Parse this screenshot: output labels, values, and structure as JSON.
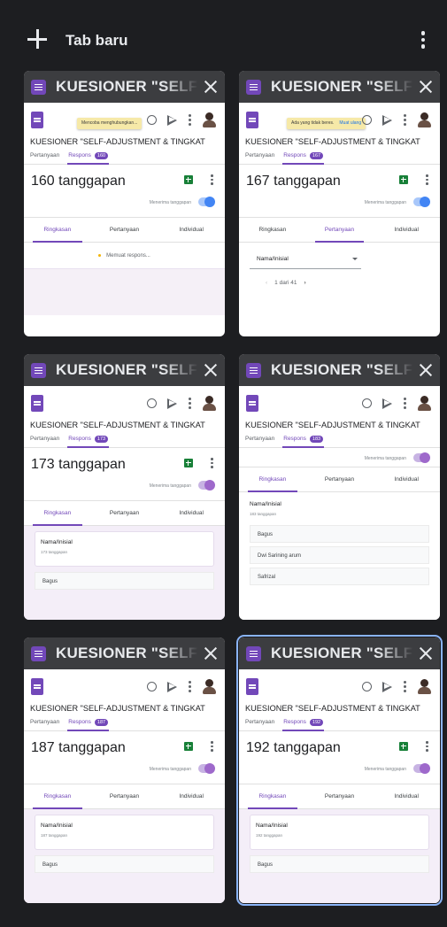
{
  "topbar": {
    "new_tab_label": "Tab baru"
  },
  "form": {
    "title": "KUESIONER \"SELF-ADJUSTMENT & TINGKAT",
    "tab_questions": "Pertanyaan",
    "tab_responses": "Respons",
    "accepting_label": "Menerima tanggapan",
    "subtab_summary": "Ringkasan",
    "subtab_question": "Pertanyaan",
    "subtab_individual": "Individual",
    "question_name": "Nama/Inisial"
  },
  "tabs": [
    {
      "title": "KUESIONER \"SELF",
      "badge": "160",
      "response_count": "160 tanggapan",
      "toast": "Mencoba menghubungkan...",
      "loading_text": "Memuat respons..."
    },
    {
      "title": "KUESIONER \"SELF",
      "badge": "167",
      "response_count": "167 tanggapan",
      "toast": "Ada yang tidak beres.",
      "toast_link": "Muat ulang",
      "dropdown_value": "Nama/Inisial",
      "pager_text": "1 dari 41"
    },
    {
      "title": "KUESIONER \"SELF",
      "badge": "173",
      "response_count": "173 tanggapan",
      "question_count": "173 tanggapan",
      "answers": [
        "Bagus"
      ]
    },
    {
      "title": "KUESIONER \"SELF",
      "badge": "183",
      "question_count": "183 tanggapan",
      "answers": [
        "Bagus",
        "Dwi Sarining arum",
        "Safrizal"
      ]
    },
    {
      "title": "KUESIONER \"SELF",
      "badge": "187",
      "response_count": "187 tanggapan",
      "question_count": "187 tanggapan",
      "answers": [
        "Bagus"
      ]
    },
    {
      "title": "KUESIONER \"SELF",
      "badge": "192",
      "response_count": "192 tanggapan",
      "question_count": "192 tanggapan",
      "answers": [
        "Bagus"
      ]
    }
  ],
  "colors": {
    "background": "#1d1e21",
    "tab_header": "#3c3d40",
    "forms_purple": "#7248b9",
    "selected_outline": "#8ab4f8"
  }
}
